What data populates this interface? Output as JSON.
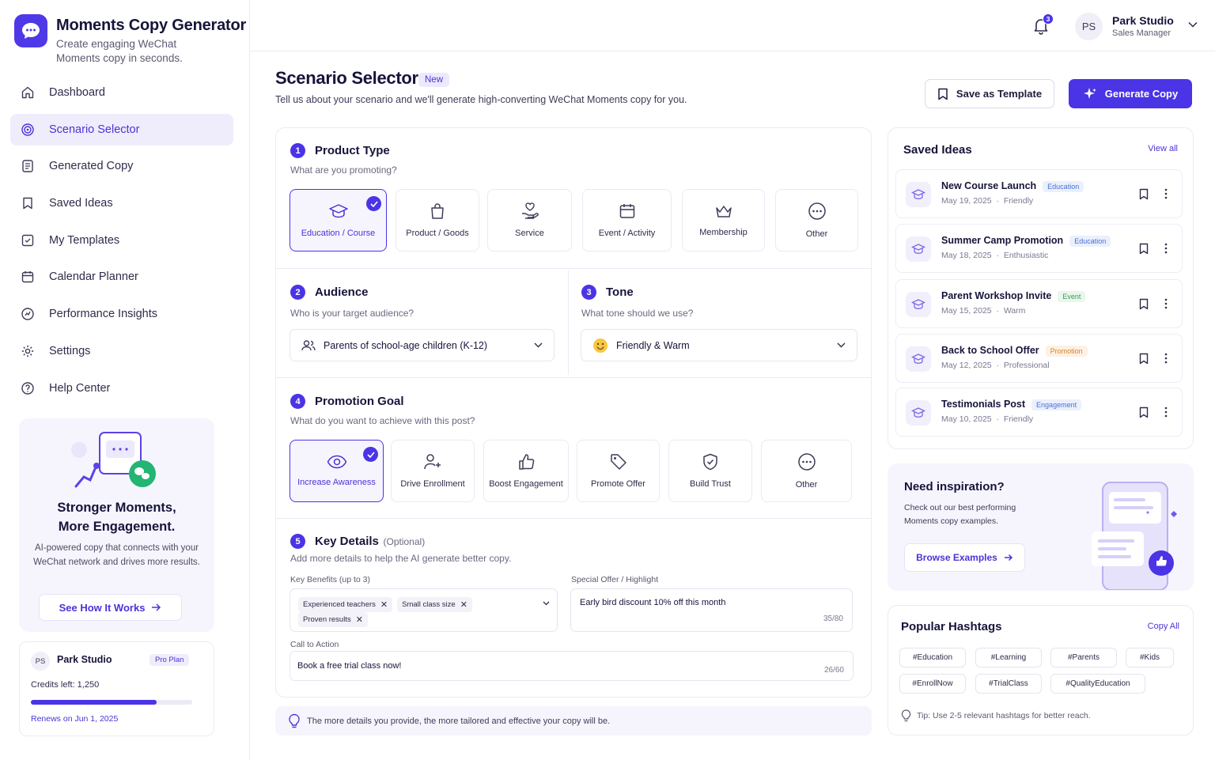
{
  "app": {
    "title": "Moments Copy Generator",
    "subtitle": "Create engaging WeChat Moments copy in seconds."
  },
  "nav": {
    "items": [
      {
        "label": "Dashboard",
        "icon": "home-icon"
      },
      {
        "label": "Scenario Selector",
        "icon": "target-icon",
        "active": true
      },
      {
        "label": "Generated Copy",
        "icon": "document-icon"
      },
      {
        "label": "Saved Ideas",
        "icon": "bookmark-icon"
      },
      {
        "label": "My Templates",
        "icon": "template-icon"
      },
      {
        "label": "Calendar Planner",
        "icon": "calendar-icon"
      },
      {
        "label": "Performance Insights",
        "icon": "chart-icon"
      },
      {
        "label": "Settings",
        "icon": "gear-icon"
      },
      {
        "label": "Help Center",
        "icon": "help-icon"
      }
    ]
  },
  "promo": {
    "title_line1": "Stronger Moments,",
    "title_line2": "More Engagement.",
    "description": "AI-powered copy that connects with your WeChat network and drives more results.",
    "button": "See How It Works"
  },
  "account": {
    "initials": "PS",
    "name": "Park Studio",
    "plan": "Pro Plan",
    "credits": "Credits left: 1,250",
    "credits_fraction": 0.78,
    "renews": "Renews on Jun 1, 2025"
  },
  "header": {
    "notification_count": "3",
    "user_initials": "PS",
    "user_name": "Park Studio",
    "user_role": "Sales Manager"
  },
  "page": {
    "title": "Scenario Selector",
    "badge": "New",
    "subtitle": "Tell us about your scenario and we'll generate high-converting WeChat Moments copy for you.",
    "save_template": "Save as Template",
    "generate": "Generate Copy"
  },
  "product_type": {
    "step": "1",
    "title": "Product Type",
    "subtitle": "What are you promoting?",
    "options": [
      {
        "label": "Education / Course",
        "icon": "graduation-cap-icon",
        "selected": true
      },
      {
        "label": "Product / Goods",
        "icon": "shopping-bag-icon"
      },
      {
        "label": "Service",
        "icon": "heart-hand-icon"
      },
      {
        "label": "Event / Activity",
        "icon": "calendar-icon"
      },
      {
        "label": "Membership",
        "icon": "crown-icon"
      },
      {
        "label": "Other",
        "icon": "more-circle-icon"
      }
    ]
  },
  "audience": {
    "step": "2",
    "title": "Audience",
    "subtitle": "Who is your target audience?",
    "value": "Parents of school-age children (K-12)"
  },
  "tone": {
    "step": "3",
    "title": "Tone",
    "subtitle": "What tone should we use?",
    "value": "Friendly & Warm"
  },
  "goal": {
    "step": "4",
    "title": "Promotion Goal",
    "subtitle": "What do you want to achieve with this post?",
    "options": [
      {
        "label": "Increase Awareness",
        "icon": "eye-icon",
        "selected": true
      },
      {
        "label": "Drive Enrollment",
        "icon": "user-plus-icon"
      },
      {
        "label": "Boost Engagement",
        "icon": "thumbs-up-icon"
      },
      {
        "label": "Promote Offer",
        "icon": "tag-icon"
      },
      {
        "label": "Build Trust",
        "icon": "shield-check-icon"
      },
      {
        "label": "Other",
        "icon": "more-circle-icon"
      }
    ]
  },
  "details": {
    "step": "5",
    "title": "Key Details",
    "optional": "(Optional)",
    "subtitle": "Add more details to help the AI generate better copy.",
    "benefits_label": "Key Benefits (up to 3)",
    "benefits": [
      "Experienced teachers",
      "Small class size",
      "Proven results"
    ],
    "offer_label": "Special Offer / Highlight",
    "offer_value": "Early bird discount 10% off this month",
    "offer_count": "35/80",
    "cta_label": "Call to Action",
    "cta_value": "Book a free trial class now!",
    "cta_count": "26/60"
  },
  "tip": "The more details you provide, the more tailored and effective your copy will be.",
  "saved_ideas": {
    "title": "Saved Ideas",
    "view_all": "View all",
    "items": [
      {
        "title": "New Course Launch",
        "tag": "Education",
        "tag_color": "#4a6fd6",
        "tag_bg": "#eaf0fc",
        "date": "May 19, 2025",
        "tone": "Friendly"
      },
      {
        "title": "Summer Camp Promotion",
        "tag": "Education",
        "tag_color": "#4a6fd6",
        "tag_bg": "#eaf0fc",
        "date": "May 18, 2025",
        "tone": "Enthusiastic"
      },
      {
        "title": "Parent Workshop Invite",
        "tag": "Event",
        "tag_color": "#3a9a5a",
        "tag_bg": "#e8f6ec",
        "date": "May 15, 2025",
        "tone": "Warm"
      },
      {
        "title": "Back to School Offer",
        "tag": "Promotion",
        "tag_color": "#d9822b",
        "tag_bg": "#fdf1e4",
        "date": "May 12, 2025",
        "tone": "Professional"
      },
      {
        "title": "Testimonials Post",
        "tag": "Engagement",
        "tag_color": "#4a6fd6",
        "tag_bg": "#eaf0fc",
        "date": "May 10, 2025",
        "tone": "Friendly"
      }
    ]
  },
  "inspiration": {
    "title": "Need inspiration?",
    "description": "Check out our best performing Moments copy examples.",
    "button": "Browse Examples"
  },
  "hashtags": {
    "title": "Popular Hashtags",
    "copy_all": "Copy All",
    "items": [
      "#Education",
      "#Learning",
      "#Parents",
      "#Kids",
      "#EnrollNow",
      "#TrialClass",
      "#QualityEducation"
    ],
    "tip": "Tip: Use 2-5 relevant hashtags for better reach."
  },
  "colors": {
    "accent": "#4a34e6",
    "accent_soft": "#efedfb",
    "wechat_green": "#22b573"
  }
}
